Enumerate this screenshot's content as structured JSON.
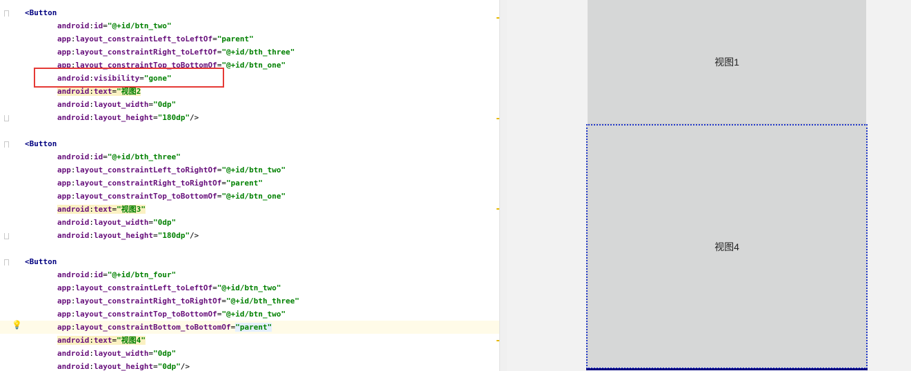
{
  "editor": {
    "lines": [
      {
        "kind": "tag",
        "text": "<Button",
        "fold": "start"
      },
      {
        "kind": "attr",
        "ns": "android",
        "name": "id",
        "value": "\"@+id/btn_two\""
      },
      {
        "kind": "attr",
        "ns": "app",
        "name": "layout_constraintLeft_toLeftOf",
        "value": "\"parent\""
      },
      {
        "kind": "attr",
        "ns": "app",
        "name": "layout_constraintRight_toLeftOf",
        "value": "\"@+id/bth_three\""
      },
      {
        "kind": "attr",
        "ns": "app",
        "name": "layout_constraintTop_toBottomOf",
        "value": "\"@+id/btn_one\""
      },
      {
        "kind": "attr",
        "ns": "android",
        "name": "visibility",
        "value": "\"gone\""
      },
      {
        "kind": "attr",
        "ns": "android",
        "name": "text",
        "value": "\"视图2",
        "hl": true
      },
      {
        "kind": "attr",
        "ns": "android",
        "name": "layout_width",
        "value": "\"0dp\""
      },
      {
        "kind": "attr",
        "ns": "android",
        "name": "layout_height",
        "value": "\"180dp\"",
        "close": "/>",
        "fold": "end"
      },
      {
        "kind": "blank"
      },
      {
        "kind": "tag",
        "text": "<Button",
        "fold": "start"
      },
      {
        "kind": "attr",
        "ns": "android",
        "name": "id",
        "value": "\"@+id/bth_three\""
      },
      {
        "kind": "attr",
        "ns": "app",
        "name": "layout_constraintLeft_toRightOf",
        "value": "\"@+id/btn_two\""
      },
      {
        "kind": "attr",
        "ns": "app",
        "name": "layout_constraintRight_toRightOf",
        "value": "\"parent\""
      },
      {
        "kind": "attr",
        "ns": "app",
        "name": "layout_constraintTop_toBottomOf",
        "value": "\"@+id/btn_one\""
      },
      {
        "kind": "attr",
        "ns": "android",
        "name": "text",
        "value": "\"视图3\"",
        "hl": true
      },
      {
        "kind": "attr",
        "ns": "android",
        "name": "layout_width",
        "value": "\"0dp\""
      },
      {
        "kind": "attr",
        "ns": "android",
        "name": "layout_height",
        "value": "\"180dp\"",
        "close": "/>",
        "fold": "end"
      },
      {
        "kind": "blank"
      },
      {
        "kind": "tag",
        "text": "<Button",
        "fold": "start"
      },
      {
        "kind": "attr",
        "ns": "android",
        "name": "id",
        "value": "\"@+id/btn_four\""
      },
      {
        "kind": "attr",
        "ns": "app",
        "name": "layout_constraintLeft_toLeftOf",
        "value": "\"@+id/btn_two\""
      },
      {
        "kind": "attr",
        "ns": "app",
        "name": "layout_constraintRight_toRightOf",
        "value": "\"@+id/bth_three\""
      },
      {
        "kind": "attr",
        "ns": "app",
        "name": "layout_constraintTop_toBottomOf",
        "value": "\"@+id/btn_two\""
      },
      {
        "kind": "attr",
        "ns": "app",
        "name": "layout_constraintBottom_toBottomOf",
        "value": "\"parent\"",
        "current": true,
        "caret": true
      },
      {
        "kind": "attr",
        "ns": "android",
        "name": "text",
        "value": "\"视图4\"",
        "hl": true
      },
      {
        "kind": "attr",
        "ns": "android",
        "name": "layout_width",
        "value": "\"0dp\""
      },
      {
        "kind": "attr",
        "ns": "android",
        "name": "layout_height",
        "value": "\"0dp\"",
        "close": "/>"
      }
    ]
  },
  "preview": {
    "btn_one_label": "视图1",
    "btn_four_label": "视图4"
  },
  "colors": {
    "highlight_box": "#e53935",
    "selection_border": "#1f36c9",
    "button_bg": "#d6d7d7"
  },
  "icons": {
    "intention": "lightbulb-icon"
  }
}
